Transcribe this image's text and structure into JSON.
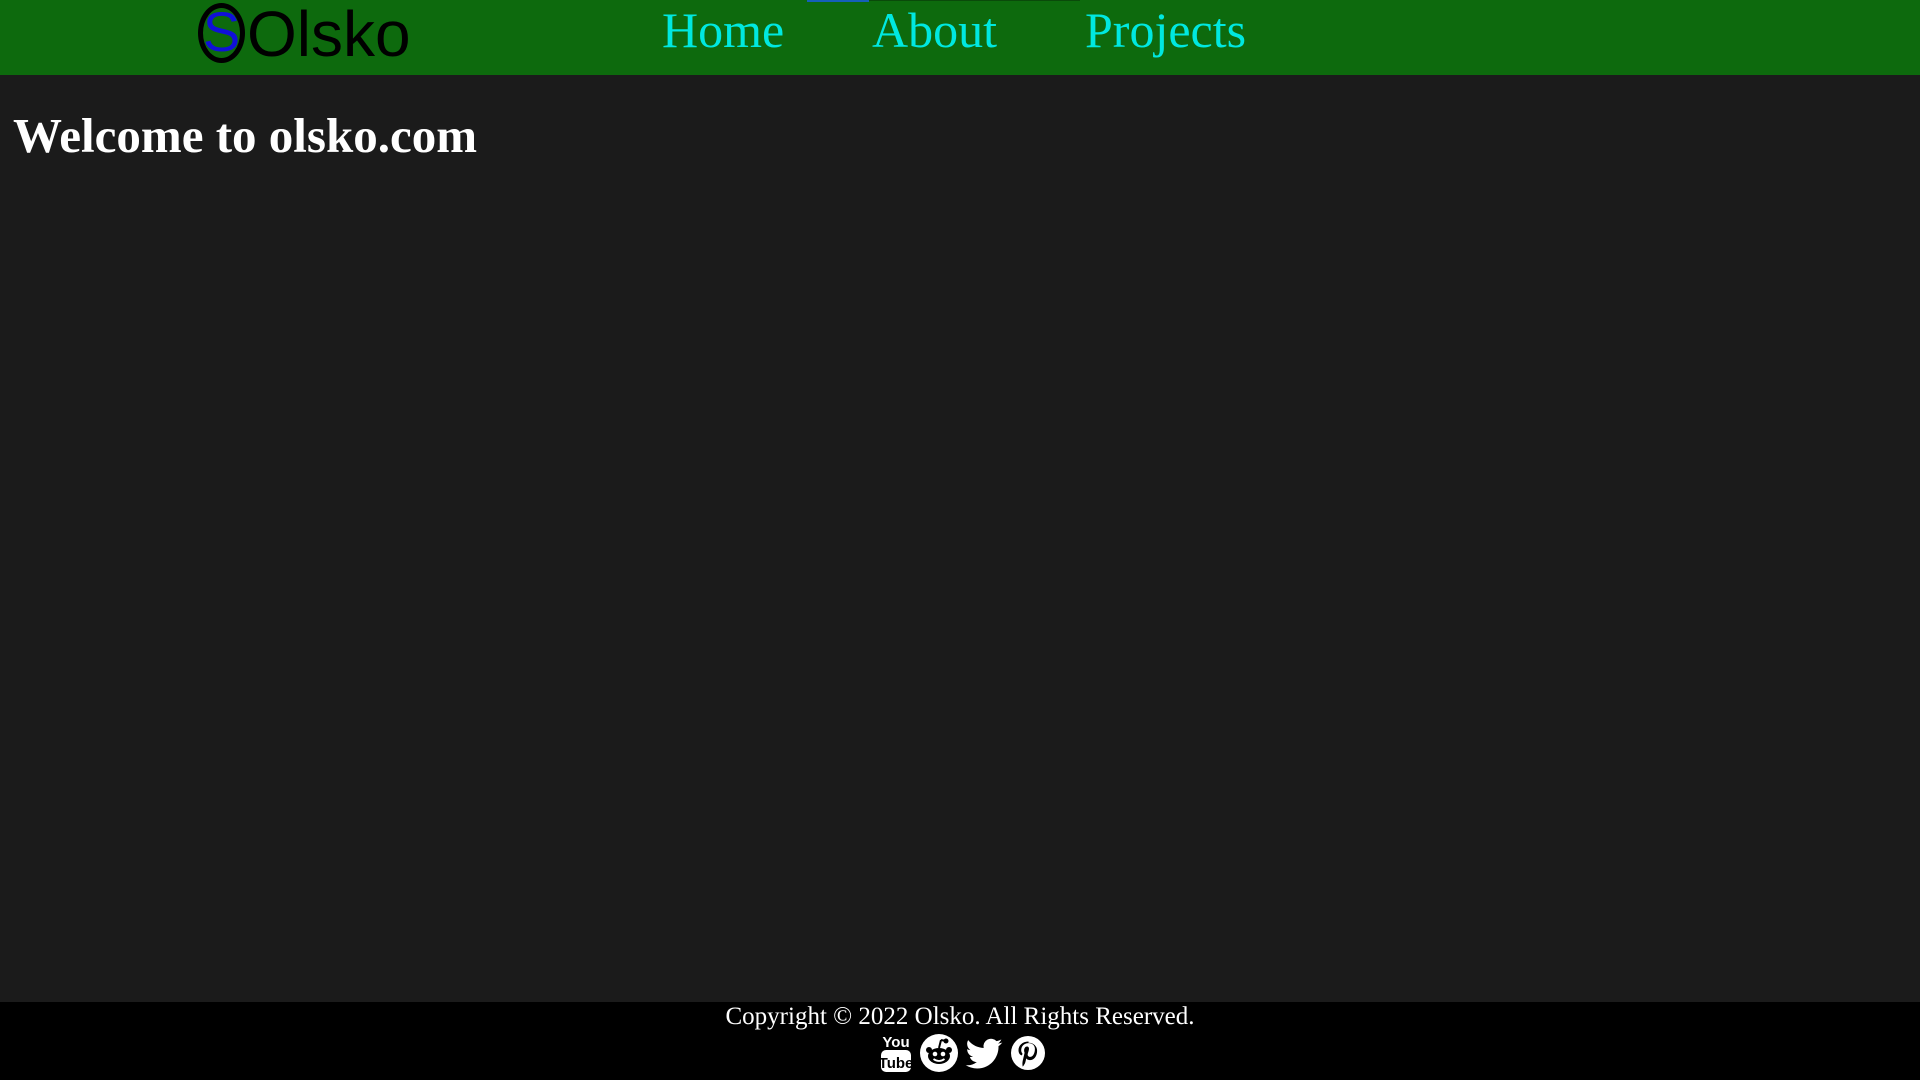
{
  "header": {
    "logo": {
      "mark_letter": "S",
      "text": "Olsko",
      "icon": "olsko-logo-icon"
    },
    "nav": [
      {
        "label": "Home"
      },
      {
        "label": "About"
      },
      {
        "label": "Projects"
      }
    ],
    "colors": {
      "background": "#0d6a0d",
      "nav_link": "#00e8e0",
      "active_indicator": "#1560b8"
    }
  },
  "main": {
    "title": "Welcome to olsko.com",
    "background": "#1b1b1b"
  },
  "footer": {
    "copyright": "Copyright © 2022 Olsko. All Rights Reserved.",
    "socials": [
      {
        "icon": "youtube-icon"
      },
      {
        "icon": "reddit-icon"
      },
      {
        "icon": "twitter-icon"
      },
      {
        "icon": "pinterest-icon"
      }
    ],
    "background": "#000000"
  }
}
